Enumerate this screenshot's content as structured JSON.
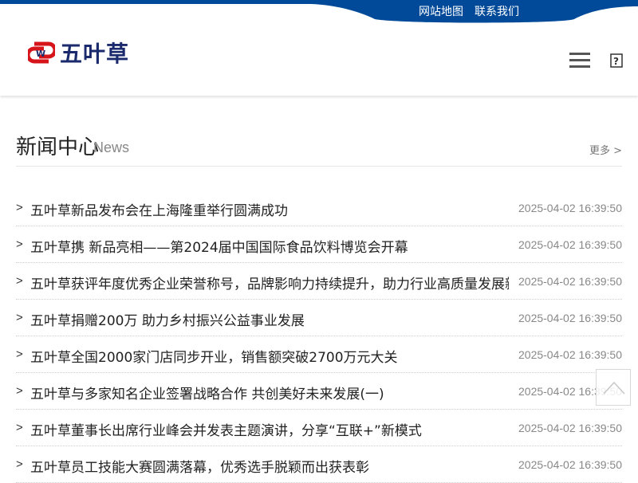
{
  "colors": {
    "brand_blue": "#004a99",
    "logo_red": "#d7141a",
    "logo_navy": "#1a2a6c"
  },
  "topbar": {
    "links": [
      "网站地图",
      "联系我们"
    ]
  },
  "header": {
    "logo_text": "五叶草",
    "menu_icon": "hamburger-menu-icon",
    "search_icon": "search-icon"
  },
  "section": {
    "title": "新闻中心",
    "subtitle": "News",
    "more_label": "更多 >"
  },
  "news": [
    {
      "title": "五叶草新品发布会在上海隆重举行圆满成功",
      "date": "2025-04-02 16:39:50"
    },
    {
      "title": "五叶草携 新品亮相——第2024届中国国际食品饮料博览会开幕",
      "date": "2025-04-02 16:39:50"
    },
    {
      "title": "五叶草获评年度优秀企业荣誉称号，品牌影响力持续提升，助力行业高质量发展新征程",
      "date": "2025-04-02 16:39:50"
    },
    {
      "title": "五叶草捐赠200万 助力乡村振兴公益事业发展",
      "date": "2025-04-02 16:39:50"
    },
    {
      "title": "五叶草全国2000家门店同步开业，销售额突破2700万元大关",
      "date": "2025-04-02 16:39:50"
    },
    {
      "title": "五叶草与多家知名企业签署战略合作 共创美好未来发展(一)",
      "date": "2025-04-02 16:39:50"
    },
    {
      "title": "五叶草董事长出席行业峰会并发表主题演讲，分享“互联+”新模式",
      "date": "2025-04-02 16:39:50"
    },
    {
      "title": "五叶草员工技能大赛圆满落幕，优秀选手脱颖而出获表彰",
      "date": "2025-04-02 16:39:50"
    }
  ],
  "back_to_top_icon": "chevron-up-icon"
}
